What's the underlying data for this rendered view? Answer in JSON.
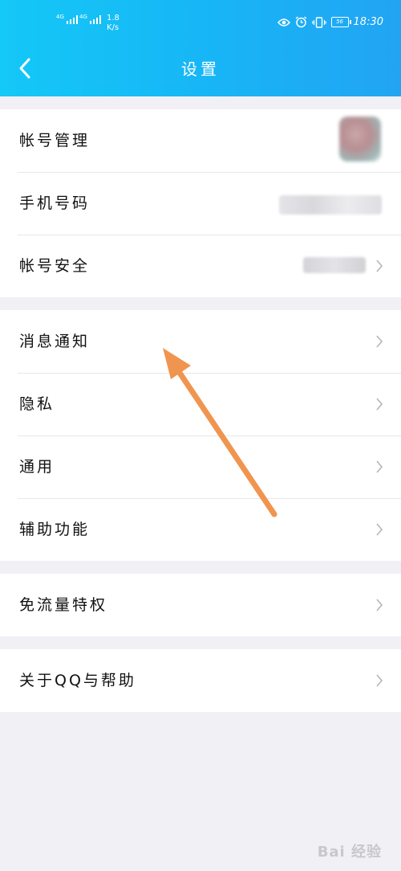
{
  "status_bar": {
    "sig1": "4G",
    "sig2": "4G",
    "speed_value": "1.8",
    "speed_unit": "K/s",
    "battery": "56",
    "time": "18:30"
  },
  "header": {
    "title": "设置"
  },
  "groups": [
    {
      "items": [
        "帐号管理",
        "手机号码",
        "帐号安全"
      ]
    },
    {
      "items": [
        "消息通知",
        "隐私",
        "通用",
        "辅助功能"
      ]
    },
    {
      "items": [
        "免流量特权"
      ]
    },
    {
      "items": [
        "关于QQ与帮助"
      ]
    }
  ],
  "annotation_color": "#f0954f",
  "header_color": "#17b6f6",
  "watermark": "Bai 经验"
}
